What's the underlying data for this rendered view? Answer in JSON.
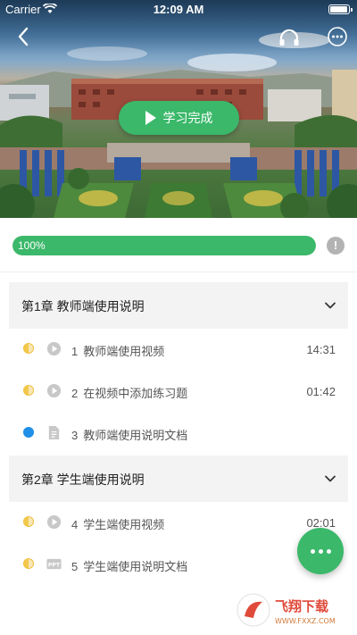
{
  "status_bar": {
    "carrier": "Carrier",
    "time": "12:09 AM"
  },
  "nav": {
    "back_icon": "chevron-left-icon",
    "audio_icon": "headphone-icon",
    "more_icon": "more-horizontal-icon"
  },
  "hero": {
    "complete_label": "学习完成"
  },
  "progress": {
    "value": 1.0,
    "label": "100%",
    "info_symbol": "!"
  },
  "colors": {
    "accent": "#3bb86a",
    "in_progress": "#f2c94c",
    "not_started": "#1f8fe8",
    "chapter_bg": "#f3f3f3"
  },
  "chapters": [
    {
      "title": "第1章  教师端使用说明",
      "lessons": [
        {
          "num": "1",
          "title": "教师端使用视频",
          "duration": "14:31",
          "type": "video",
          "status": "in-progress"
        },
        {
          "num": "2",
          "title": "在视频中添加练习题",
          "duration": "01:42",
          "type": "video",
          "status": "in-progress"
        },
        {
          "num": "3",
          "title": "教师端使用说明文档",
          "duration": "",
          "type": "document",
          "status": "not-started"
        }
      ]
    },
    {
      "title": "第2章  学生端使用说明",
      "lessons": [
        {
          "num": "4",
          "title": "学生端使用视频",
          "duration": "02:01",
          "type": "video",
          "status": "in-progress"
        },
        {
          "num": "5",
          "title": "学生端使用说明文档",
          "duration": "",
          "type": "ppt",
          "status": "in-progress"
        }
      ]
    }
  ],
  "fab": {
    "icon": "more-dots-icon"
  },
  "watermark": {
    "text": "飞翔下载",
    "url": "WWW.FXXZ.COM"
  }
}
